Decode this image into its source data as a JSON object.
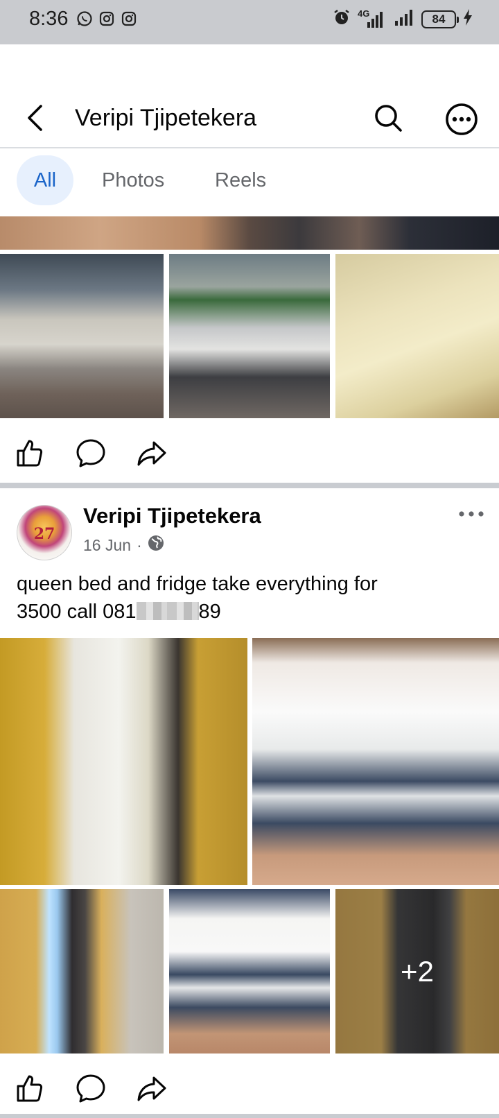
{
  "status_bar": {
    "time": "8:36",
    "network": "4G",
    "battery": "84"
  },
  "header": {
    "title": "Veripi Tjipetekera"
  },
  "tabs": [
    {
      "label": "All",
      "active": true
    },
    {
      "label": "Photos",
      "active": false
    },
    {
      "label": "Reels",
      "active": false
    }
  ],
  "post": {
    "author": "Veripi Tjipetekera",
    "avatar_text": "27",
    "date": "16 Jun",
    "separator": "·",
    "privacy_icon": "globe-icon",
    "text_line1": "queen bed and fridge take everything for",
    "text_prefix": "3500 call 081",
    "text_suffix": "89",
    "more_photos": "+2"
  },
  "colors": {
    "accent": "#1b65c9",
    "accent_bg": "#e7f0fd",
    "secondary_text": "#65676b",
    "divider": "#c9ccd1",
    "status_bar": "#c9cbcf"
  }
}
